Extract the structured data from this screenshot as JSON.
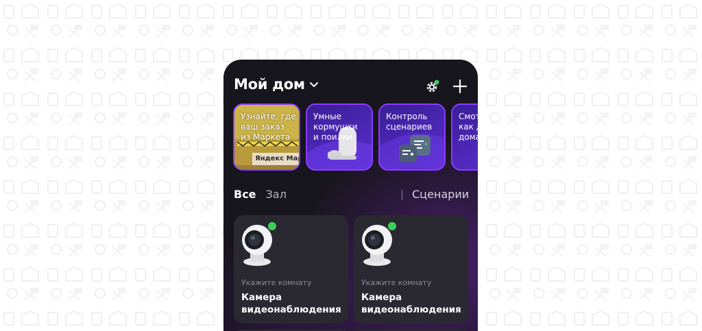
{
  "header": {
    "title": "Мой дом"
  },
  "stories": [
    {
      "label": "Узнайте, где\nваш заказ\nиз Маркета",
      "sign_text": "Яндекс Мар"
    },
    {
      "label": "Умные\nкормушки\nи поилки"
    },
    {
      "label": "Контроль\nсценариев"
    },
    {
      "label": "Смот\nкак д\nдома"
    }
  ],
  "tabs": [
    {
      "label": "Все",
      "active": true
    },
    {
      "label": "Зал",
      "active": false
    }
  ],
  "scenarios_label": "Сценарии",
  "devices": [
    {
      "room": "Укажите комнату",
      "name": "Камера\nвидеонаблюдения",
      "status": "online"
    },
    {
      "room": "Укажите комнату",
      "name": "Камера\nвидеонаблюдения",
      "status": "online"
    }
  ],
  "colors": {
    "background": "#17151d",
    "accent_border": "#8a3cff",
    "card": "#2a2932",
    "online": "#3ccf5a"
  }
}
